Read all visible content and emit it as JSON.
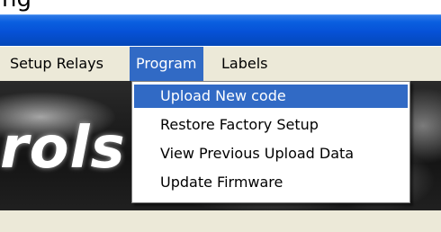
{
  "header_fragment": "ng",
  "menubar": {
    "items": [
      {
        "label": "Setup Relays"
      },
      {
        "label": "Program"
      },
      {
        "label": "Labels"
      }
    ]
  },
  "banner": {
    "logo_text": "rols"
  },
  "program_menu": {
    "items": [
      {
        "label": "Upload New code",
        "selected": true
      },
      {
        "label": "Restore Factory Setup",
        "selected": false
      },
      {
        "label": "View Previous Upload Data",
        "selected": false
      },
      {
        "label": "Update Firmware",
        "selected": false
      }
    ]
  },
  "colors": {
    "titlebar": "#0a5fe0",
    "menubar_bg": "#ece9d8",
    "highlight": "#316ac5"
  }
}
